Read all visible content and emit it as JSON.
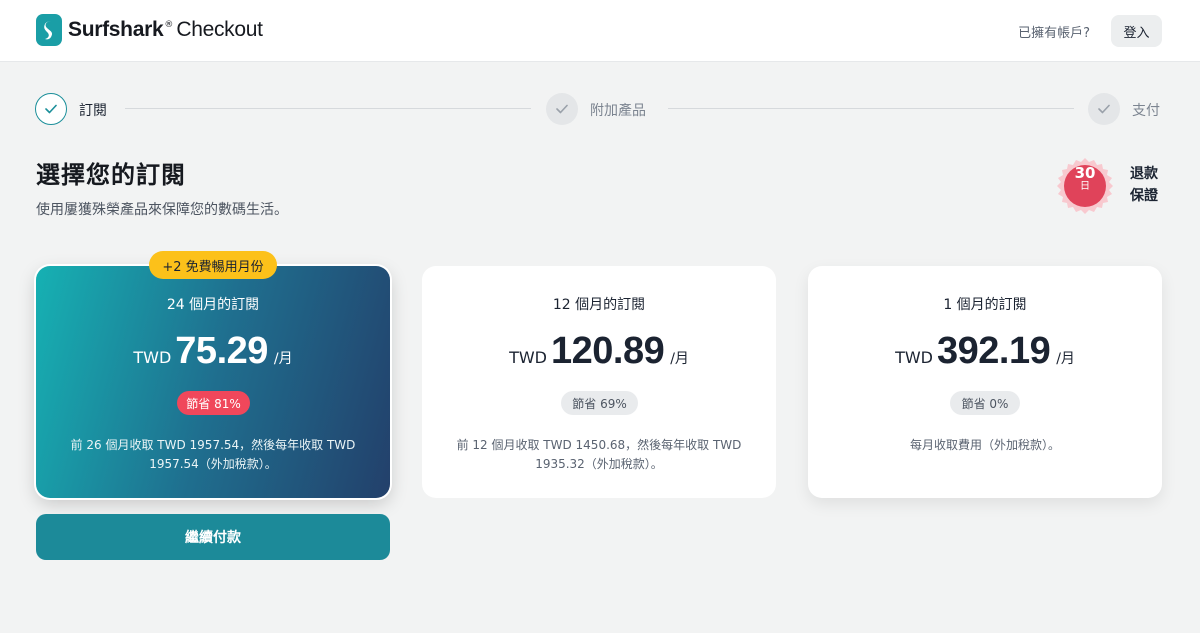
{
  "header": {
    "brand": "Surfshark",
    "reg_mark": "®",
    "product": "Checkout",
    "have_account": "已擁有帳戶?",
    "login_label": "登入"
  },
  "steps": [
    {
      "label": "訂閱",
      "state": "active"
    },
    {
      "label": "附加產品",
      "state": "pending"
    },
    {
      "label": "支付",
      "state": "pending"
    }
  ],
  "main": {
    "title": "選擇您的訂閱",
    "subtitle": "使用屢獲殊榮產品來保障您的數碼生活。"
  },
  "guarantee": {
    "days": "30",
    "unit": "日",
    "line1": "退款",
    "line2": "保證"
  },
  "plans": [
    {
      "badge": "+2 免費暢用月份",
      "name": "24 個月的訂閱",
      "currency": "TWD",
      "price": "75.29",
      "per": "/月",
      "savings": "節省 81%",
      "note": "前 26 個月收取 TWD 1957.54，然後每年收取 TWD 1957.54（外加稅款）。",
      "selected": true
    },
    {
      "name": "12 個月的訂閱",
      "currency": "TWD",
      "price": "120.89",
      "per": "/月",
      "savings": "節省 69%",
      "note": "前 12 個月收取 TWD 1450.68，然後每年收取 TWD 1935.32（外加稅款）。",
      "selected": false
    },
    {
      "name": "1 個月的訂閱",
      "currency": "TWD",
      "price": "392.19",
      "per": "/月",
      "savings": "節省 0%",
      "note": "每月收取費用（外加稅款）。",
      "selected": false
    }
  ],
  "cta": {
    "label": "繼續付款"
  },
  "colors": {
    "accent": "#1c8a99",
    "badge_yellow": "#fcc11a",
    "savings_red": "#f0475b",
    "seal_red": "#e0435a"
  }
}
